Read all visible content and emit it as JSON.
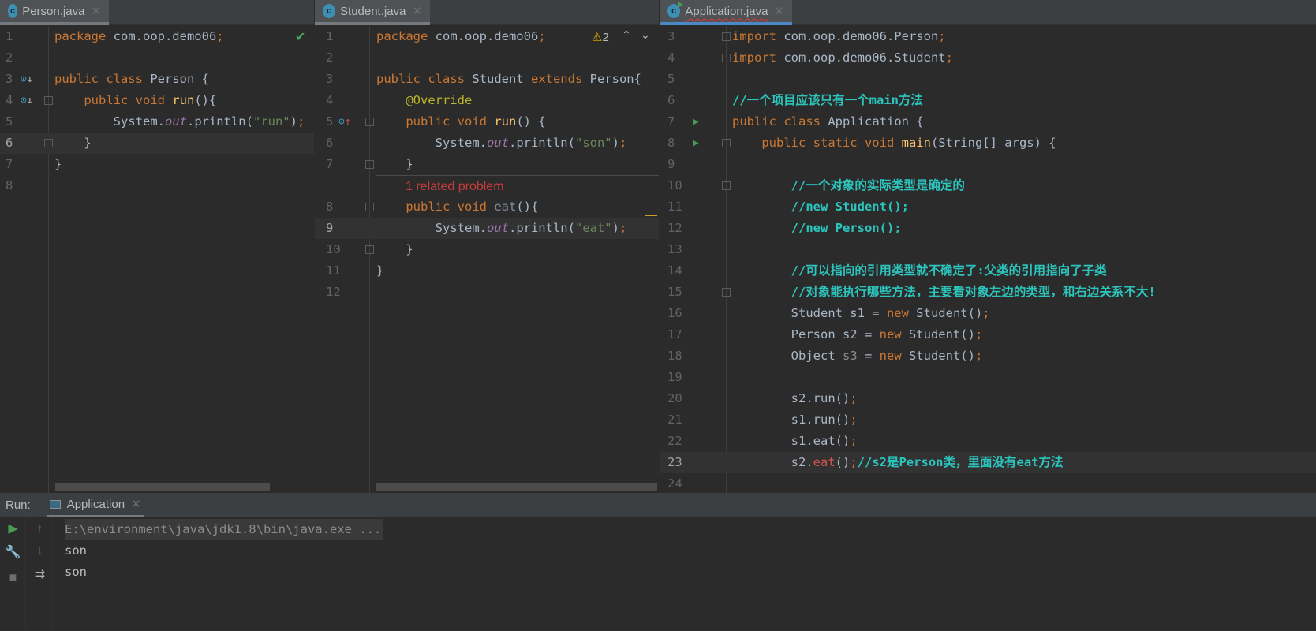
{
  "editors": [
    {
      "tab": "Person.java",
      "active": false,
      "status": "check",
      "current": "6",
      "lines": [
        {
          "n": "1",
          "t": [
            [
              "kw",
              "package "
            ],
            [
              "id",
              "com.oop.demo06"
            ],
            [
              "kw",
              ";"
            ]
          ]
        },
        {
          "n": "2",
          "t": []
        },
        {
          "n": "3",
          "t": [
            [
              "kw",
              "public class "
            ],
            [
              "id",
              "Person {"
            ]
          ]
        },
        {
          "n": "4",
          "t": [
            [
              "id",
              "    "
            ],
            [
              "kw",
              "public void "
            ],
            [
              "fn",
              "run"
            ],
            [
              "id",
              "(){"
            ]
          ]
        },
        {
          "n": "5",
          "t": [
            [
              "id",
              "        System."
            ],
            [
              "out",
              "out"
            ],
            [
              "id",
              ".println("
            ],
            [
              "str",
              "\"run\""
            ],
            [
              "id",
              ")"
            ],
            [
              "kw",
              ";"
            ]
          ]
        },
        {
          "n": "6",
          "t": [
            [
              "id",
              "    }"
            ]
          ]
        },
        {
          "n": "7",
          "t": [
            [
              "id",
              "}"
            ]
          ]
        },
        {
          "n": "8",
          "t": []
        }
      ]
    },
    {
      "tab": "Student.java",
      "active": false,
      "warning_count": "2",
      "current": "9",
      "inlay": "1 related problem",
      "lines": [
        {
          "n": "1",
          "t": [
            [
              "kw",
              "package "
            ],
            [
              "id",
              "com.oop.demo06"
            ],
            [
              "kw",
              ";"
            ]
          ]
        },
        {
          "n": "2",
          "t": []
        },
        {
          "n": "3",
          "t": [
            [
              "kw",
              "public class "
            ],
            [
              "id",
              "Student "
            ],
            [
              "kw",
              "extends "
            ],
            [
              "id",
              "Person{"
            ]
          ]
        },
        {
          "n": "4",
          "t": [
            [
              "id",
              "    "
            ],
            [
              "ann",
              "@Override"
            ]
          ]
        },
        {
          "n": "5",
          "t": [
            [
              "id",
              "    "
            ],
            [
              "kw",
              "public void "
            ],
            [
              "fn",
              "run"
            ],
            [
              "id",
              "() {"
            ]
          ]
        },
        {
          "n": "6",
          "t": [
            [
              "id",
              "        System."
            ],
            [
              "out",
              "out"
            ],
            [
              "id",
              ".println("
            ],
            [
              "str",
              "\"son\""
            ],
            [
              "id",
              ")"
            ],
            [
              "kw",
              ";"
            ]
          ]
        },
        {
          "n": "7",
          "t": [
            [
              "id",
              "    }"
            ]
          ]
        },
        {
          "n": "8",
          "t": [
            [
              "id",
              "    "
            ],
            [
              "kw",
              "public void "
            ],
            [
              "unused",
              "eat"
            ],
            [
              "id",
              "(){"
            ]
          ]
        },
        {
          "n": "9",
          "t": [
            [
              "id",
              "        System."
            ],
            [
              "out",
              "out"
            ],
            [
              "id",
              ".println("
            ],
            [
              "str",
              "\"eat\""
            ],
            [
              "id",
              ")"
            ],
            [
              "kw",
              ";"
            ]
          ]
        },
        {
          "n": "10",
          "t": [
            [
              "id",
              "    }"
            ]
          ]
        },
        {
          "n": "11",
          "t": [
            [
              "id",
              "}"
            ]
          ]
        },
        {
          "n": "12",
          "t": []
        }
      ]
    },
    {
      "tab": "Application.java",
      "active": true,
      "current": "23",
      "lines": [
        {
          "n": "3",
          "t": [
            [
              "kw",
              "import "
            ],
            [
              "id",
              "com.oop.demo06.Person"
            ],
            [
              "kw",
              ";"
            ]
          ]
        },
        {
          "n": "4",
          "t": [
            [
              "kw",
              "import "
            ],
            [
              "id",
              "com.oop.demo06.Student"
            ],
            [
              "kw",
              ";"
            ]
          ]
        },
        {
          "n": "5",
          "t": []
        },
        {
          "n": "6",
          "t": [
            [
              "cm",
              "//一个项目应该只有一个main方法"
            ]
          ]
        },
        {
          "n": "7",
          "t": [
            [
              "kw",
              "public class "
            ],
            [
              "id",
              "Application {"
            ]
          ]
        },
        {
          "n": "8",
          "t": [
            [
              "id",
              "    "
            ],
            [
              "kw",
              "public static void "
            ],
            [
              "fn",
              "main"
            ],
            [
              "id",
              "(String[] args) {"
            ]
          ]
        },
        {
          "n": "9",
          "t": []
        },
        {
          "n": "10",
          "t": [
            [
              "id",
              "        "
            ],
            [
              "cm",
              "//一个对象的实际类型是确定的"
            ]
          ]
        },
        {
          "n": "11",
          "t": [
            [
              "id",
              "        "
            ],
            [
              "cm",
              "//new Student();"
            ]
          ]
        },
        {
          "n": "12",
          "t": [
            [
              "id",
              "        "
            ],
            [
              "cm",
              "//new Person();"
            ]
          ]
        },
        {
          "n": "13",
          "t": []
        },
        {
          "n": "14",
          "t": [
            [
              "id",
              "        "
            ],
            [
              "cm",
              "//可以指向的引用类型就不确定了:父类的引用指向了子类"
            ]
          ]
        },
        {
          "n": "15",
          "t": [
            [
              "id",
              "        "
            ],
            [
              "cm",
              "//对象能执行哪些方法，主要看对象左边的类型，和右边关系不大!"
            ]
          ]
        },
        {
          "n": "16",
          "t": [
            [
              "id",
              "        Student s1 = "
            ],
            [
              "kw",
              "new "
            ],
            [
              "id",
              "Student()"
            ],
            [
              "kw",
              ";"
            ]
          ]
        },
        {
          "n": "17",
          "t": [
            [
              "id",
              "        Person s2 = "
            ],
            [
              "kw",
              "new "
            ],
            [
              "id",
              "Student()"
            ],
            [
              "kw",
              ";"
            ]
          ]
        },
        {
          "n": "18",
          "t": [
            [
              "id",
              "        Object "
            ],
            [
              "gray",
              "s3"
            ],
            [
              "id",
              " = "
            ],
            [
              "kw",
              "new "
            ],
            [
              "id",
              "Student()"
            ],
            [
              "kw",
              ";"
            ]
          ]
        },
        {
          "n": "19",
          "t": []
        },
        {
          "n": "20",
          "t": [
            [
              "id",
              "        s2.run()"
            ],
            [
              "kw",
              ";"
            ]
          ]
        },
        {
          "n": "21",
          "t": [
            [
              "id",
              "        s1.run()"
            ],
            [
              "kw",
              ";"
            ]
          ]
        },
        {
          "n": "22",
          "t": [
            [
              "id",
              "        s1.eat()"
            ],
            [
              "kw",
              ";"
            ]
          ]
        },
        {
          "n": "23",
          "t": [
            [
              "id",
              "        s2."
            ],
            [
              "err",
              "eat"
            ],
            [
              "id",
              "()"
            ],
            [
              "kw",
              ";"
            ],
            [
              "cm",
              "//s2是Person类，里面没有eat方法"
            ]
          ]
        },
        {
          "n": "24",
          "t": []
        }
      ]
    }
  ],
  "run": {
    "label": "Run:",
    "tab": "Application",
    "output": [
      "E:\\environment\\java\\jdk1.8\\bin\\java.exe ...",
      "son",
      "son"
    ]
  },
  "colors": {
    "accent": "#4a88c7",
    "keyword": "#cc7832",
    "string": "#6a8759",
    "comment": "#2cc5bd",
    "error": "#d25252"
  }
}
